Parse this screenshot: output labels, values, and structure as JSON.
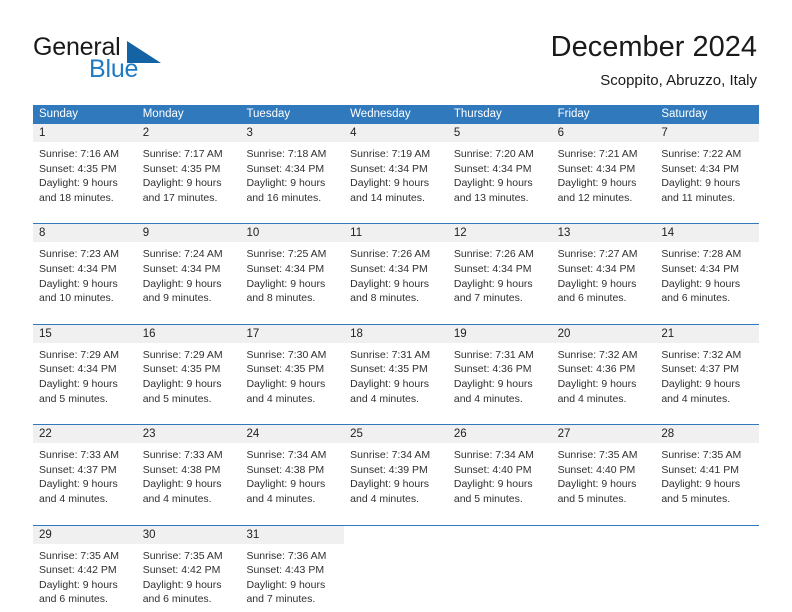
{
  "brand": {
    "word1": "General",
    "word2": "Blue",
    "accent_color": "#1f7ac4",
    "triangle_color": "#1464a5"
  },
  "header": {
    "title": "December 2024",
    "subtitle": "Scoppito, Abruzzo, Italy"
  },
  "calendar": {
    "header_bg": "#3079bd",
    "daynum_bg": "#f0f0f0",
    "weekdays": [
      "Sunday",
      "Monday",
      "Tuesday",
      "Wednesday",
      "Thursday",
      "Friday",
      "Saturday"
    ],
    "weeks": [
      [
        {
          "day": "1",
          "lines": [
            "Sunrise: 7:16 AM",
            "Sunset: 4:35 PM",
            "Daylight: 9 hours",
            "and 18 minutes."
          ]
        },
        {
          "day": "2",
          "lines": [
            "Sunrise: 7:17 AM",
            "Sunset: 4:35 PM",
            "Daylight: 9 hours",
            "and 17 minutes."
          ]
        },
        {
          "day": "3",
          "lines": [
            "Sunrise: 7:18 AM",
            "Sunset: 4:34 PM",
            "Daylight: 9 hours",
            "and 16 minutes."
          ]
        },
        {
          "day": "4",
          "lines": [
            "Sunrise: 7:19 AM",
            "Sunset: 4:34 PM",
            "Daylight: 9 hours",
            "and 14 minutes."
          ]
        },
        {
          "day": "5",
          "lines": [
            "Sunrise: 7:20 AM",
            "Sunset: 4:34 PM",
            "Daylight: 9 hours",
            "and 13 minutes."
          ]
        },
        {
          "day": "6",
          "lines": [
            "Sunrise: 7:21 AM",
            "Sunset: 4:34 PM",
            "Daylight: 9 hours",
            "and 12 minutes."
          ]
        },
        {
          "day": "7",
          "lines": [
            "Sunrise: 7:22 AM",
            "Sunset: 4:34 PM",
            "Daylight: 9 hours",
            "and 11 minutes."
          ]
        }
      ],
      [
        {
          "day": "8",
          "lines": [
            "Sunrise: 7:23 AM",
            "Sunset: 4:34 PM",
            "Daylight: 9 hours",
            "and 10 minutes."
          ]
        },
        {
          "day": "9",
          "lines": [
            "Sunrise: 7:24 AM",
            "Sunset: 4:34 PM",
            "Daylight: 9 hours",
            "and 9 minutes."
          ]
        },
        {
          "day": "10",
          "lines": [
            "Sunrise: 7:25 AM",
            "Sunset: 4:34 PM",
            "Daylight: 9 hours",
            "and 8 minutes."
          ]
        },
        {
          "day": "11",
          "lines": [
            "Sunrise: 7:26 AM",
            "Sunset: 4:34 PM",
            "Daylight: 9 hours",
            "and 8 minutes."
          ]
        },
        {
          "day": "12",
          "lines": [
            "Sunrise: 7:26 AM",
            "Sunset: 4:34 PM",
            "Daylight: 9 hours",
            "and 7 minutes."
          ]
        },
        {
          "day": "13",
          "lines": [
            "Sunrise: 7:27 AM",
            "Sunset: 4:34 PM",
            "Daylight: 9 hours",
            "and 6 minutes."
          ]
        },
        {
          "day": "14",
          "lines": [
            "Sunrise: 7:28 AM",
            "Sunset: 4:34 PM",
            "Daylight: 9 hours",
            "and 6 minutes."
          ]
        }
      ],
      [
        {
          "day": "15",
          "lines": [
            "Sunrise: 7:29 AM",
            "Sunset: 4:34 PM",
            "Daylight: 9 hours",
            "and 5 minutes."
          ]
        },
        {
          "day": "16",
          "lines": [
            "Sunrise: 7:29 AM",
            "Sunset: 4:35 PM",
            "Daylight: 9 hours",
            "and 5 minutes."
          ]
        },
        {
          "day": "17",
          "lines": [
            "Sunrise: 7:30 AM",
            "Sunset: 4:35 PM",
            "Daylight: 9 hours",
            "and 4 minutes."
          ]
        },
        {
          "day": "18",
          "lines": [
            "Sunrise: 7:31 AM",
            "Sunset: 4:35 PM",
            "Daylight: 9 hours",
            "and 4 minutes."
          ]
        },
        {
          "day": "19",
          "lines": [
            "Sunrise: 7:31 AM",
            "Sunset: 4:36 PM",
            "Daylight: 9 hours",
            "and 4 minutes."
          ]
        },
        {
          "day": "20",
          "lines": [
            "Sunrise: 7:32 AM",
            "Sunset: 4:36 PM",
            "Daylight: 9 hours",
            "and 4 minutes."
          ]
        },
        {
          "day": "21",
          "lines": [
            "Sunrise: 7:32 AM",
            "Sunset: 4:37 PM",
            "Daylight: 9 hours",
            "and 4 minutes."
          ]
        }
      ],
      [
        {
          "day": "22",
          "lines": [
            "Sunrise: 7:33 AM",
            "Sunset: 4:37 PM",
            "Daylight: 9 hours",
            "and 4 minutes."
          ]
        },
        {
          "day": "23",
          "lines": [
            "Sunrise: 7:33 AM",
            "Sunset: 4:38 PM",
            "Daylight: 9 hours",
            "and 4 minutes."
          ]
        },
        {
          "day": "24",
          "lines": [
            "Sunrise: 7:34 AM",
            "Sunset: 4:38 PM",
            "Daylight: 9 hours",
            "and 4 minutes."
          ]
        },
        {
          "day": "25",
          "lines": [
            "Sunrise: 7:34 AM",
            "Sunset: 4:39 PM",
            "Daylight: 9 hours",
            "and 4 minutes."
          ]
        },
        {
          "day": "26",
          "lines": [
            "Sunrise: 7:34 AM",
            "Sunset: 4:40 PM",
            "Daylight: 9 hours",
            "and 5 minutes."
          ]
        },
        {
          "day": "27",
          "lines": [
            "Sunrise: 7:35 AM",
            "Sunset: 4:40 PM",
            "Daylight: 9 hours",
            "and 5 minutes."
          ]
        },
        {
          "day": "28",
          "lines": [
            "Sunrise: 7:35 AM",
            "Sunset: 4:41 PM",
            "Daylight: 9 hours",
            "and 5 minutes."
          ]
        }
      ],
      [
        {
          "day": "29",
          "lines": [
            "Sunrise: 7:35 AM",
            "Sunset: 4:42 PM",
            "Daylight: 9 hours",
            "and 6 minutes."
          ]
        },
        {
          "day": "30",
          "lines": [
            "Sunrise: 7:35 AM",
            "Sunset: 4:42 PM",
            "Daylight: 9 hours",
            "and 6 minutes."
          ]
        },
        {
          "day": "31",
          "lines": [
            "Sunrise: 7:36 AM",
            "Sunset: 4:43 PM",
            "Daylight: 9 hours",
            "and 7 minutes."
          ]
        },
        {
          "day": "",
          "lines": []
        },
        {
          "day": "",
          "lines": []
        },
        {
          "day": "",
          "lines": []
        },
        {
          "day": "",
          "lines": []
        }
      ]
    ]
  }
}
